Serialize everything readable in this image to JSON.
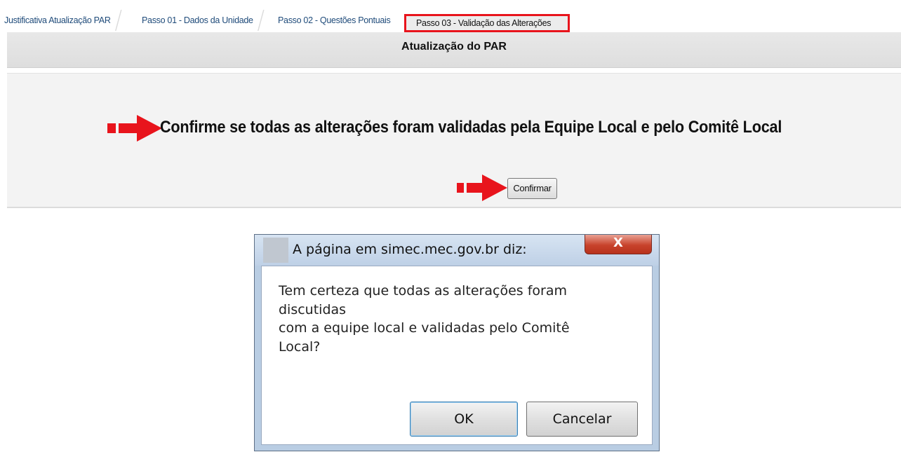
{
  "tabs": [
    {
      "label": "Justificativa Atualização PAR"
    },
    {
      "label": "Passo 01 - Dados da Unidade"
    },
    {
      "label": "Passo 02 - Questões Pontuais"
    },
    {
      "label": "Passo 03 - Validação das Alterações",
      "active": true
    }
  ],
  "header": {
    "title": "Atualização do PAR"
  },
  "main": {
    "message": "Confirme se todas as alterações foram validadas pela Equipe Local e pelo Comitê Local",
    "confirm_button": "Confirmar"
  },
  "dialog": {
    "title": "A página em simec.mec.gov.br diz:",
    "close_label": "X",
    "message_lines": [
      "Tem certeza que todas as alterações foram",
      "discutidas",
      "com a equipe local e validadas pelo Comitê",
      "Local?"
    ],
    "ok_label": "OK",
    "cancel_label": "Cancelar"
  },
  "colors": {
    "highlight": "#e8141c",
    "arrow": "#e8141c",
    "tab_text": "#1f4b7a"
  },
  "icons": [
    "red-arrow-icon",
    "close-icon"
  ]
}
